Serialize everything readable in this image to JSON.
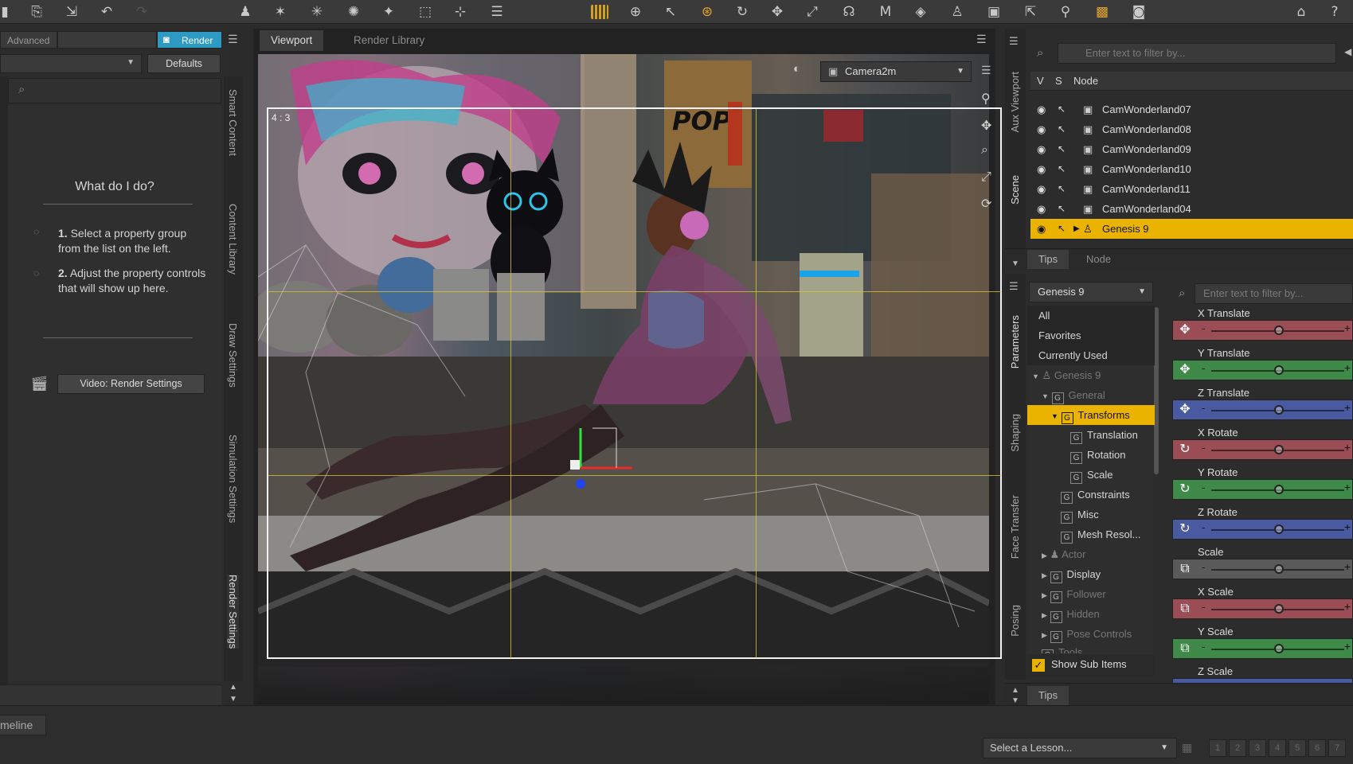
{
  "toolbar": {
    "icons": [
      "save-icon",
      "export-icon",
      "undo-icon",
      "redo-icon",
      "figure-icon",
      "light-icon",
      "spotlight-icon",
      "distant-light-icon",
      "point-light-icon",
      "camera-icon",
      "null-icon",
      "list-icon",
      "render-grid-icon",
      "orbit-icon",
      "select-icon",
      "universal-tool-icon",
      "rotate-icon",
      "translate-icon",
      "scale-icon",
      "joint-icon",
      "morph-icon",
      "surface-icon",
      "pose-icon",
      "camera-view-icon",
      "node-select-icon",
      "active-pose-icon",
      "render-icon",
      "help-icon"
    ]
  },
  "left_pane": {
    "tab_advanced": "Advanced",
    "tab_render": "Render",
    "defaults_label": "Defaults",
    "help_title": "What do I do?",
    "step1_num": "1.",
    "step1_text": "Select a property group from the list on the left.",
    "step2_num": "2.",
    "step2_text": "Adjust the property controls that will show up here.",
    "video_button": "Video: Render Settings",
    "side_tabs": [
      "Smart Content",
      "Content Library",
      "Draw Settings",
      "Simulation Settings",
      "Render Settings"
    ]
  },
  "viewport": {
    "tab_viewport": "Viewport",
    "tab_render_library": "Render Library",
    "camera_name": "Camera2m",
    "aspect_label": "4 : 3"
  },
  "scene_pane": {
    "side_tabs": [
      "Aux Viewport",
      "Scene"
    ],
    "search_placeholder": "Enter text to filter by...",
    "col_v": "V",
    "col_s": "S",
    "col_node": "Node",
    "rows": [
      "CamWonderland07",
      "CamWonderland08",
      "CamWonderland09",
      "CamWonderland10",
      "CamWonderland11",
      "CamWonderland04",
      "Genesis 9"
    ],
    "tab_tips": "Tips",
    "tab_node": "Node"
  },
  "params_pane": {
    "side_tabs": [
      "Parameters",
      "Shaping",
      "Face Transfer",
      "Posing"
    ],
    "node_select": "Genesis 9",
    "search_placeholder": "Enter text to filter by...",
    "tree": [
      {
        "label": "All",
        "state": "normal"
      },
      {
        "label": "Favorites",
        "state": "normal"
      },
      {
        "label": "Currently Used",
        "state": "normal"
      },
      {
        "label": "Genesis 9",
        "state": "dim"
      },
      {
        "label": "General",
        "state": "dim"
      },
      {
        "label": "Transforms",
        "state": "active"
      },
      {
        "label": "Translation",
        "state": "normal"
      },
      {
        "label": "Rotation",
        "state": "normal"
      },
      {
        "label": "Scale",
        "state": "normal"
      },
      {
        "label": "Constraints",
        "state": "normal"
      },
      {
        "label": "Misc",
        "state": "normal"
      },
      {
        "label": "Mesh Resol...",
        "state": "normal"
      },
      {
        "label": "Actor",
        "state": "dim"
      },
      {
        "label": "Display",
        "state": "normal"
      },
      {
        "label": "Follower",
        "state": "dim"
      },
      {
        "label": "Hidden",
        "state": "dim"
      },
      {
        "label": "Pose Controls",
        "state": "dim"
      },
      {
        "label": "Tools",
        "state": "dim"
      }
    ],
    "show_sub_items": "Show Sub Items",
    "params": [
      {
        "label": "X Translate",
        "color": "#9a4d55",
        "icon": "✥",
        "value": 0.5
      },
      {
        "label": "Y Translate",
        "color": "#3f8a48",
        "icon": "✥",
        "value": 0.5
      },
      {
        "label": "Z Translate",
        "color": "#4a5aa0",
        "icon": "✥",
        "value": 0.5
      },
      {
        "label": "X Rotate",
        "color": "#9a4d55",
        "icon": "↻",
        "value": 0.5
      },
      {
        "label": "Y Rotate",
        "color": "#3f8a48",
        "icon": "↻",
        "value": 0.5
      },
      {
        "label": "Z Rotate",
        "color": "#4a5aa0",
        "icon": "↻",
        "value": 0.5
      },
      {
        "label": "Scale",
        "color": "#5a5a5a",
        "icon": "⧉",
        "value": 0.5
      },
      {
        "label": "X Scale",
        "color": "#9a4d55",
        "icon": "⧉",
        "value": 0.5
      },
      {
        "label": "Y Scale",
        "color": "#3f8a48",
        "icon": "⧉",
        "value": 0.5
      },
      {
        "label": "Z Scale",
        "color": "#4a5aa0",
        "icon": "⧉",
        "value": 0.5
      }
    ],
    "tips_tab": "Tips"
  },
  "bottom": {
    "timeline_tab": "meline",
    "lesson_select": "Select a Lesson...",
    "pages": [
      "1",
      "2",
      "3",
      "4",
      "5",
      "6",
      "7"
    ]
  }
}
